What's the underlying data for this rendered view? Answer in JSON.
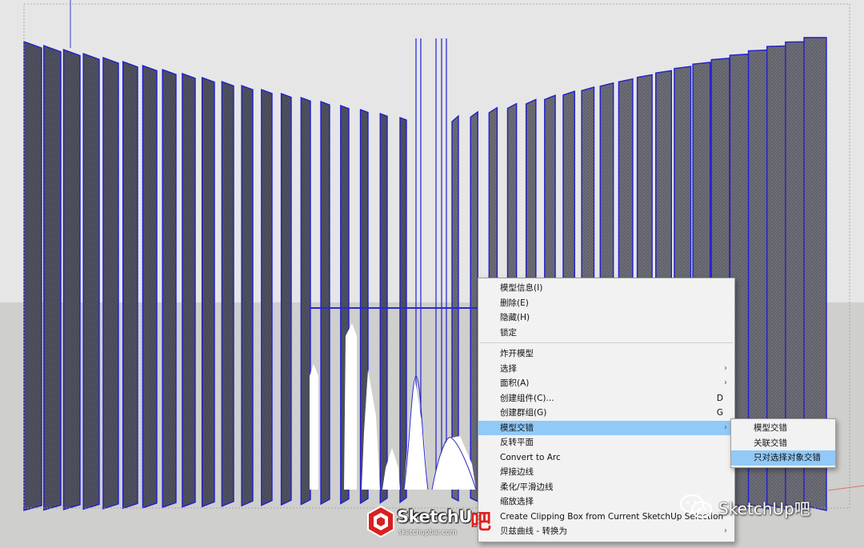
{
  "scene": {
    "sky_color": "#e6e6e6",
    "ground_color": "#cfcfcd",
    "panel_left_color": "#4f5160",
    "panel_right_color": "#6c6c76",
    "edge_color": "#1f1fd4",
    "panel_count": 40
  },
  "context_menu": {
    "groups": [
      [
        {
          "label": "模型信息(I)"
        },
        {
          "label": "删除(E)"
        },
        {
          "label": "隐藏(H)"
        },
        {
          "label": "锁定"
        }
      ],
      [
        {
          "label": "炸开模型"
        },
        {
          "label": "选择",
          "submenu": true
        },
        {
          "label": "面积(A)",
          "submenu": true
        },
        {
          "label": "创建组件(C)...",
          "shortcut": "D"
        },
        {
          "label": "创建群组(G)",
          "shortcut": "G"
        },
        {
          "label": "模型交错",
          "submenu": true,
          "highlighted": true
        },
        {
          "label": "反转平面"
        },
        {
          "label": "Convert to Arc"
        },
        {
          "label": "焊接边线"
        },
        {
          "label": "柔化/平滑边线"
        },
        {
          "label": "缩放选择"
        },
        {
          "label": "Create Clipping Box from Current SketchUp Selection"
        },
        {
          "label": "贝兹曲线 - 转换为",
          "submenu": true
        }
      ]
    ],
    "highlight_color": "#91c9f7"
  },
  "submenu": {
    "items": [
      {
        "label": "模型交错"
      },
      {
        "label": "关联交错"
      },
      {
        "label": "只对选择对象交错",
        "highlighted": true
      }
    ]
  },
  "watermarks": {
    "logo_text": "SketchUp",
    "logo_suffix": "吧",
    "logo_url": "sketchupbar.com",
    "wechat_text": "SketchUp吧"
  }
}
